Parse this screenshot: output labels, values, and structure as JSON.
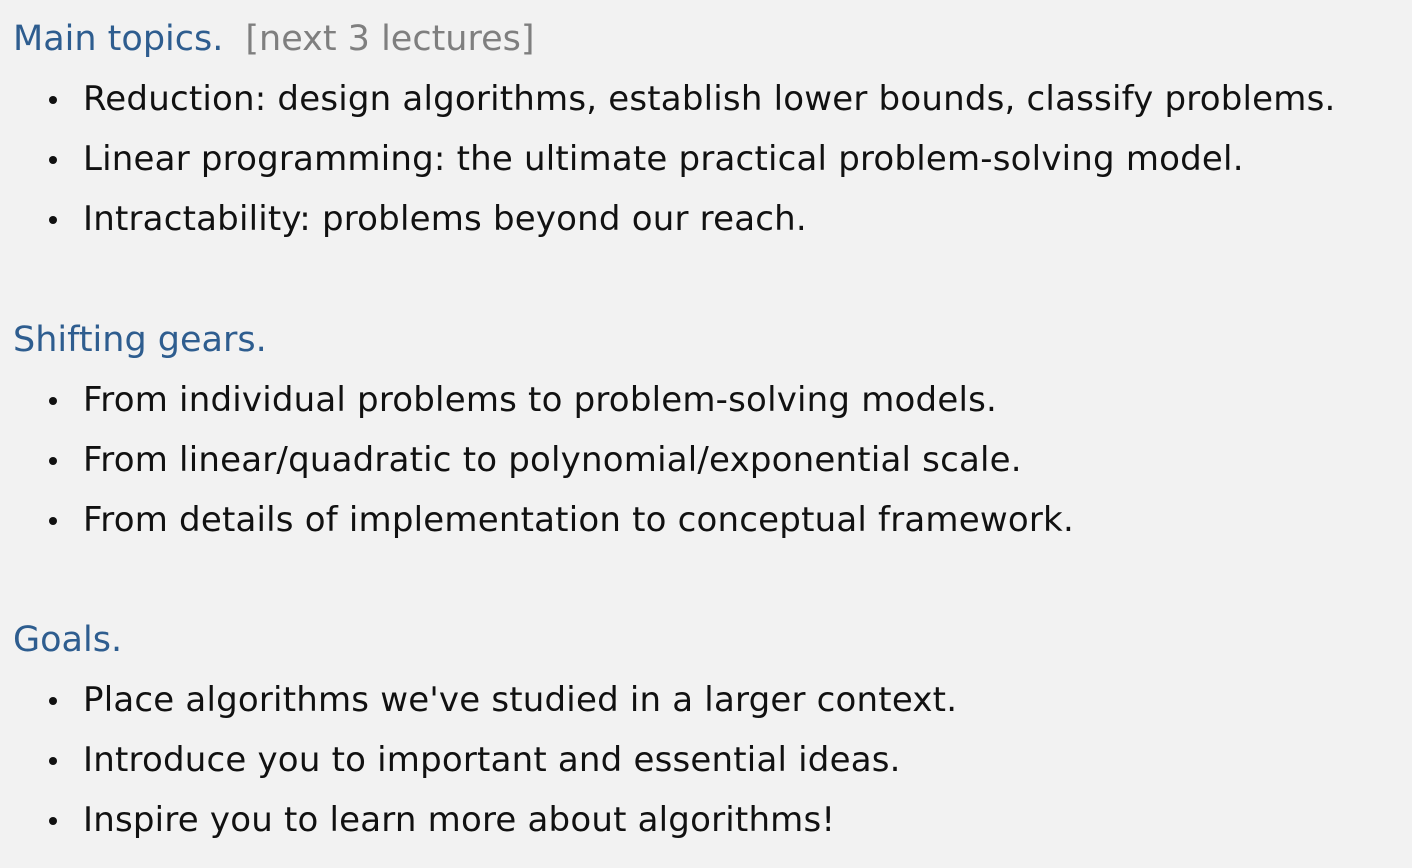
{
  "sections": [
    {
      "heading": "Main topics.",
      "note": "[next 3 lectures]",
      "items": [
        "Reduction: design algorithms, establish lower bounds, classify problems.",
        "Linear programming: the ultimate practical problem-solving model.",
        "Intractability:  problems beyond our reach."
      ]
    },
    {
      "heading": "Shifting gears.",
      "items": [
        "From individual problems to problem-solving models.",
        "From linear/quadratic to polynomial/exponential scale.",
        "From details of implementation to conceptual framework."
      ]
    },
    {
      "heading": "Goals.",
      "items": [
        "Place algorithms we've studied in a larger context.",
        "Introduce you to important and essential ideas.",
        "Inspire you to learn more about algorithms!"
      ]
    }
  ],
  "colors": {
    "heading": "#2e5d8f",
    "note": "#7f7f7f",
    "text": "#111111",
    "background": "#f2f2f2"
  }
}
